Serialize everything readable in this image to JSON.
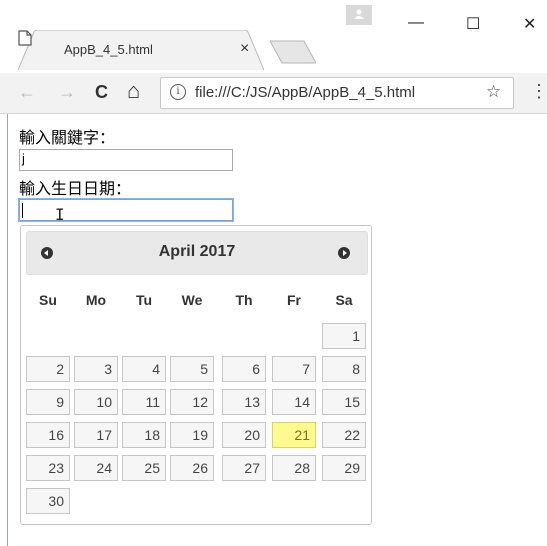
{
  "browser": {
    "tab_title": "AppB_4_5.html",
    "tab_close": "×",
    "window_minimize": "—",
    "window_maximize": "☐",
    "window_close": "✕",
    "url": "file:///C:/JS/AppB/AppB_4_5.html",
    "info_glyph": "i",
    "star_glyph": "☆",
    "menu_glyph": "⋮",
    "back_glyph": "←",
    "forward_glyph": "→",
    "reload_glyph": "C",
    "home_glyph": "⌂"
  },
  "form": {
    "keyword_label": "輸入關鍵字：",
    "keyword_value": "j",
    "birthday_label": "輸入生日日期：",
    "birthday_value": ""
  },
  "datepicker": {
    "month_title": "April 2017",
    "weekdays": [
      "Su",
      "Mo",
      "Tu",
      "We",
      "Th",
      "Fr",
      "Sa"
    ],
    "first_weekday_index": 6,
    "days_in_month": 30,
    "today": 21,
    "colors": {
      "today_bg": "#fffa90",
      "day_bg": "#f6f6f6",
      "header_bg": "#e9e9e9"
    }
  }
}
